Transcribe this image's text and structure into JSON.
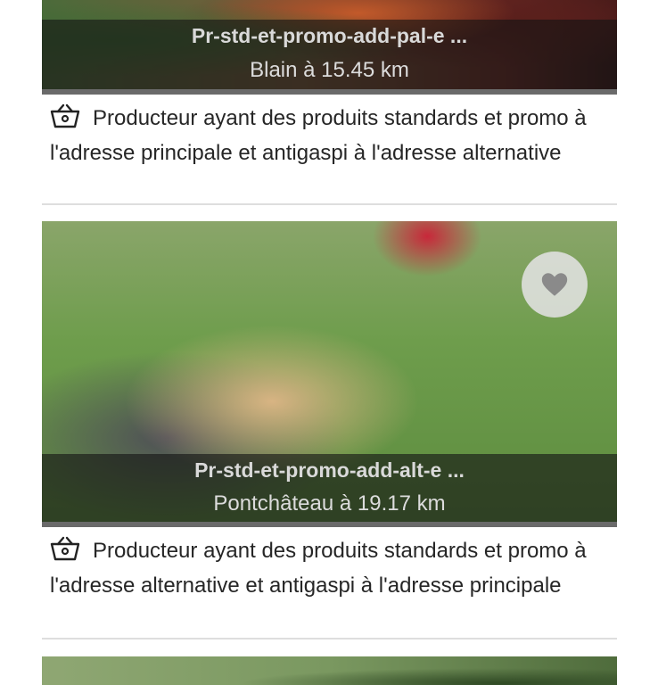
{
  "producers": [
    {
      "name": "Pr-std-et-promo-add-pal-e ...",
      "location": "Blain à 15.45 km",
      "description": "Producteur ayant des produits standards et promo à l'adresse principale et antigaspi à l'adresse alternative",
      "icon": "basket-icon"
    },
    {
      "name": "Pr-std-et-promo-add-alt-e ...",
      "location": "Pontchâteau à 19.17 km",
      "description": "Producteur ayant des produits standards et promo à l'adresse alternative et antigaspi à l'adresse principale",
      "icon": "basket-icon",
      "favorite_icon": "heart-icon"
    }
  ],
  "colors": {
    "caption_overlay": "#141414",
    "heart": "#8a8a8a",
    "favorite_bg": "#e1e1e1",
    "divider": "#dedede"
  }
}
